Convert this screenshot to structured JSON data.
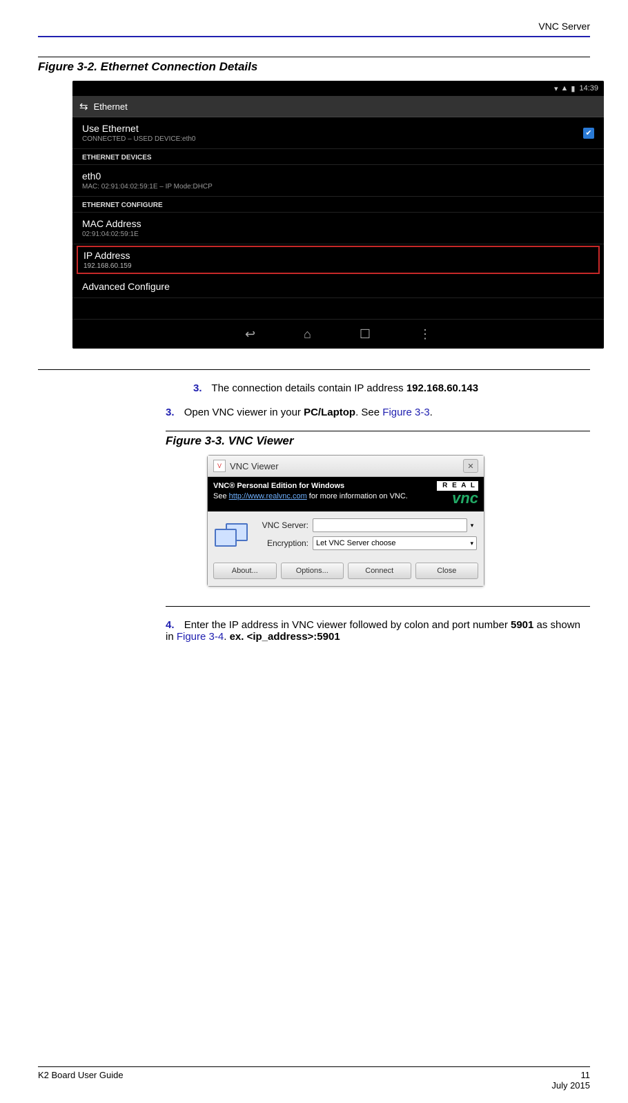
{
  "header": {
    "title": "VNC Server"
  },
  "figure32": {
    "caption": "Figure 3-2. Ethernet Connection Details",
    "statusTime": "14:39",
    "ethTitle": "Ethernet",
    "useEth": {
      "title": "Use Ethernet",
      "sub": "CONNECTED – USED DEVICE:eth0"
    },
    "sec1": "ETHERNET DEVICES",
    "eth0": {
      "title": "eth0",
      "sub": "MAC: 02:91:04:02:59:1E – IP Mode:DHCP"
    },
    "sec2": "ETHERNET CONFIGURE",
    "mac": {
      "title": "MAC Address",
      "sub": "02:91:04:02:59:1E"
    },
    "ip": {
      "title": "IP Address",
      "sub": "192.168.60.159"
    },
    "adv": {
      "title": "Advanced Configure"
    }
  },
  "step3a": {
    "num": "3.",
    "text_a": "The connection details contain IP address ",
    "ip": "192.168.60.143"
  },
  "step3b": {
    "num": "3.",
    "text_a": "Open VNC viewer in your ",
    "bold": "PC/Laptop",
    "text_b": ". See ",
    "link": "Figure 3-3",
    "text_c": "."
  },
  "figure33": {
    "caption": "Figure 3-3.  VNC Viewer",
    "winTitle": "VNC Viewer",
    "line1": "VNC® Personal Edition for Windows",
    "line2a": "See ",
    "url": "http://www.realvnc.com",
    "line2b": " for more information on VNC.",
    "logo1": "R E A L",
    "logo2": "vnc",
    "lblServer": "VNC Server:",
    "lblEnc": "Encryption:",
    "encVal": "Let VNC Server choose",
    "btnAbout": "About...",
    "btnOptions": "Options...",
    "btnConnect": "Connect",
    "btnClose": "Close"
  },
  "step4": {
    "num": "4.",
    "text_a": "Enter the IP address in VNC viewer followed by colon and port number ",
    "bold1": "5901",
    "text_b": " as shown in ",
    "link": "Figure 3-4",
    "text_c": ".  ",
    "bold2": "ex. <ip_address>:5901"
  },
  "footer": {
    "left": "K2 Board User Guide",
    "pageNum": "11",
    "date": "July 2015"
  }
}
